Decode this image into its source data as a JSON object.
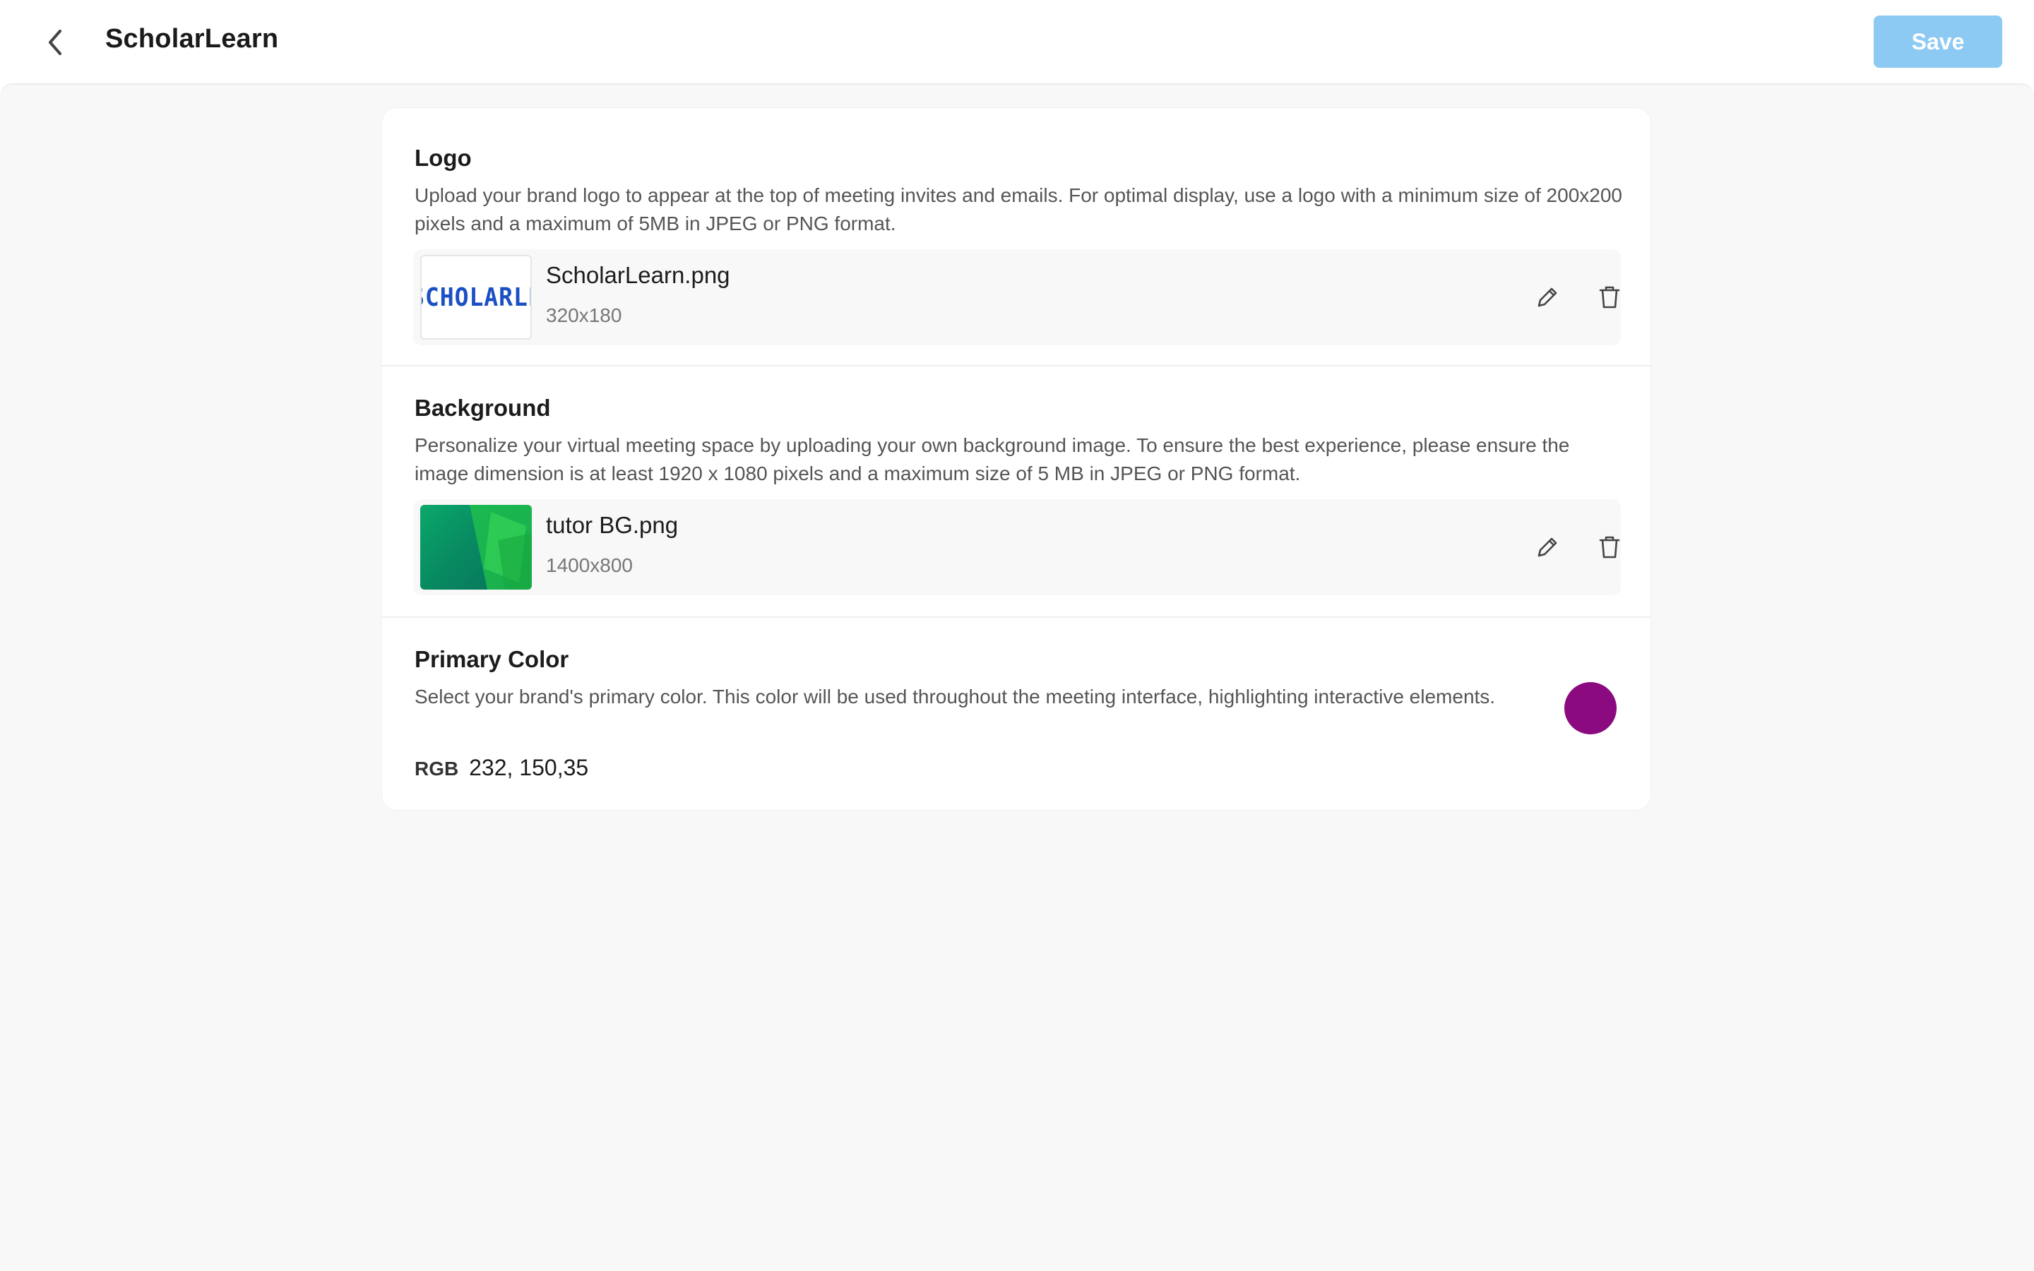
{
  "header": {
    "title": "ScholarLearn",
    "save_label": "Save"
  },
  "colors": {
    "save_button": "#8cc9f3",
    "primary_swatch": "#8b0a80",
    "logo_text": "#1b4fc4"
  },
  "sections": {
    "logo": {
      "title": "Logo",
      "description": "Upload your brand logo to appear at the top of meeting invites and emails. For optimal display, use a logo with a minimum size of 200x200 pixels and a maximum of 5MB in JPEG or PNG format.",
      "file": {
        "thumbnail_text": "SCHOLARLEARN",
        "name": "ScholarLearn.png",
        "dimensions": "320x180"
      }
    },
    "background": {
      "title": "Background",
      "description": "Personalize your virtual meeting space by uploading your own background image. To ensure the best experience, please ensure the image dimension is at least 1920 x 1080 pixels and a maximum size of 5 MB in JPEG or PNG format.",
      "file": {
        "name": "tutor BG.png",
        "dimensions": "1400x800"
      }
    },
    "primary_color": {
      "title": "Primary Color",
      "description": "Select your brand's primary color. This color will be used throughout the meeting interface, highlighting interactive elements.",
      "rgb_label": "RGB",
      "rgb_value": "232, 150,35"
    }
  },
  "icons": {
    "back": "chevron-left-icon",
    "edit": "pencil-icon",
    "delete": "trash-icon"
  }
}
